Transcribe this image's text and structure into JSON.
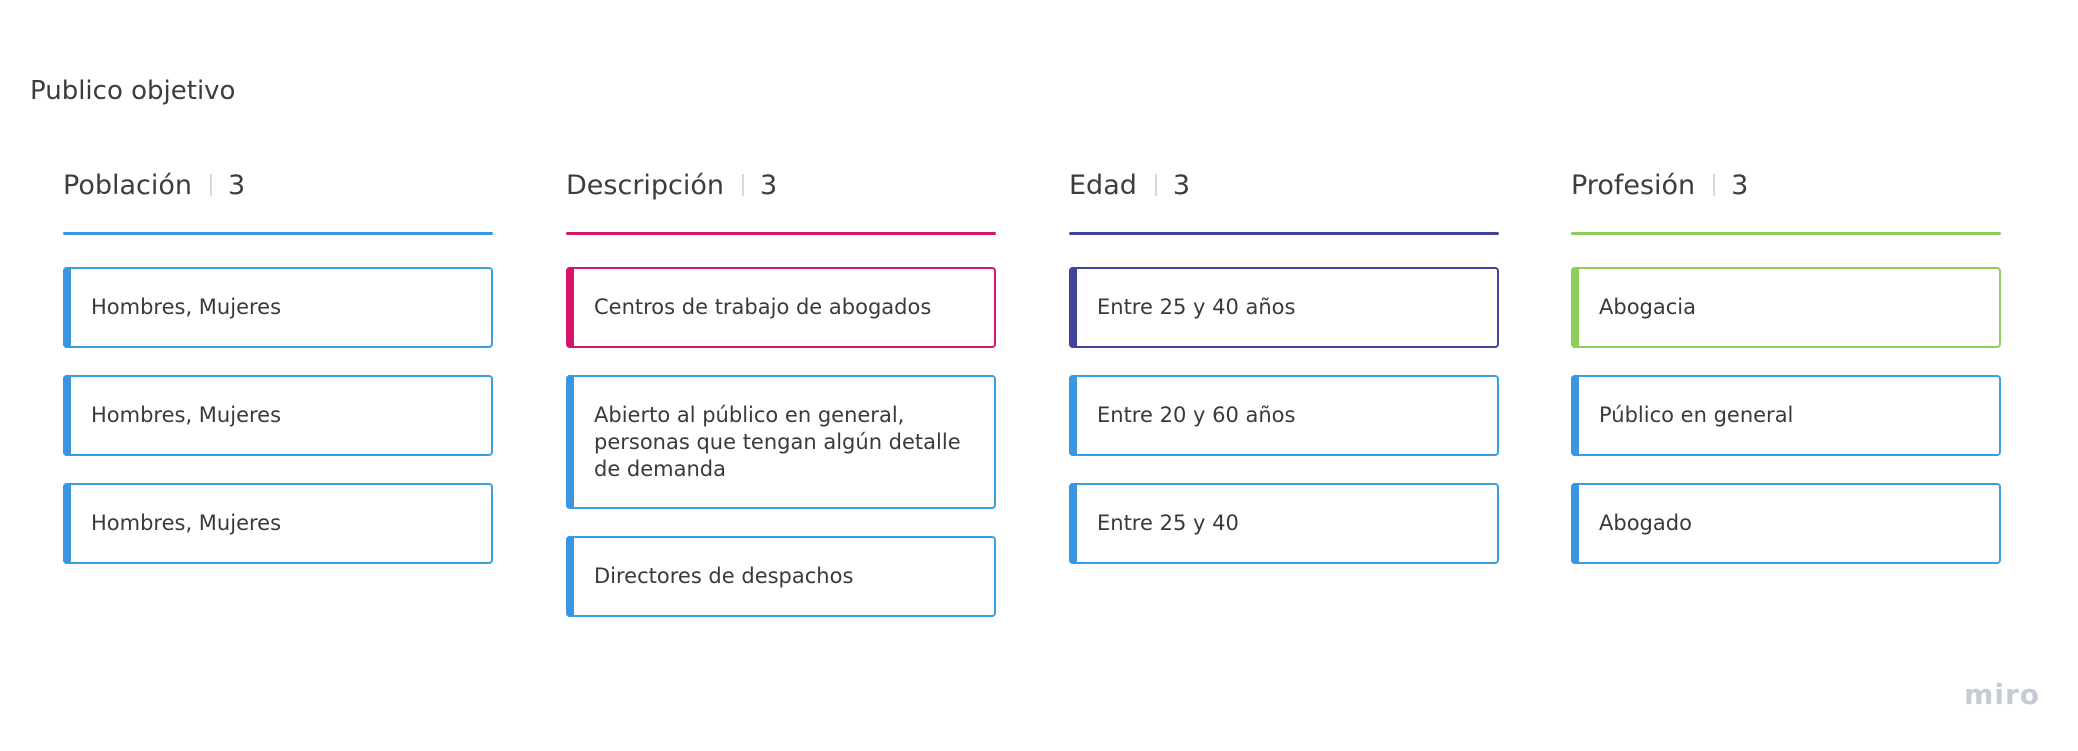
{
  "board": {
    "title": "Publico objetivo"
  },
  "columns": [
    {
      "title": "Población",
      "count": "3",
      "color": "#3a96e2",
      "cards": [
        {
          "text": "Hombres, Mujeres",
          "bar": "#3a96e2",
          "border": "#3aa0e5"
        },
        {
          "text": "Hombres, Mujeres",
          "bar": "#3a96e2",
          "border": "#3aa0e5"
        },
        {
          "text": "Hombres, Mujeres",
          "bar": "#3a96e2",
          "border": "#3aa0e5"
        }
      ]
    },
    {
      "title": "Descripción",
      "count": "3",
      "color": "#d4166a",
      "cards": [
        {
          "text": "Centros de trabajo de abogados",
          "bar": "#d4166a",
          "border": "#d4166a"
        },
        {
          "text": "Abierto al público en general, personas que tengan algún detalle de demanda",
          "bar": "#3a96e2",
          "border": "#3aa0e5"
        },
        {
          "text": "Directores de despachos",
          "bar": "#3a96e2",
          "border": "#3aa0e5"
        }
      ]
    },
    {
      "title": "Edad",
      "count": "3",
      "color": "#41449b",
      "cards": [
        {
          "text": "Entre 25 y 40 años",
          "bar": "#41449b",
          "border": "#41449b"
        },
        {
          "text": "Entre 20 y 60 años",
          "bar": "#3a96e2",
          "border": "#3aa0e5"
        },
        {
          "text": "Entre 25 y 40",
          "bar": "#3a96e2",
          "border": "#3aa0e5"
        }
      ]
    },
    {
      "title": "Profesión",
      "count": "3",
      "color": "#8fcd5a",
      "cards": [
        {
          "text": "Abogacia",
          "bar": "#8fcd5a",
          "border": "#8fcd5a"
        },
        {
          "text": "Público en general",
          "bar": "#3a96e2",
          "border": "#3aa0e5"
        },
        {
          "text": "Abogado",
          "bar": "#3a96e2",
          "border": "#3aa0e5"
        }
      ]
    }
  ],
  "branding": {
    "logo_text": "miro"
  }
}
